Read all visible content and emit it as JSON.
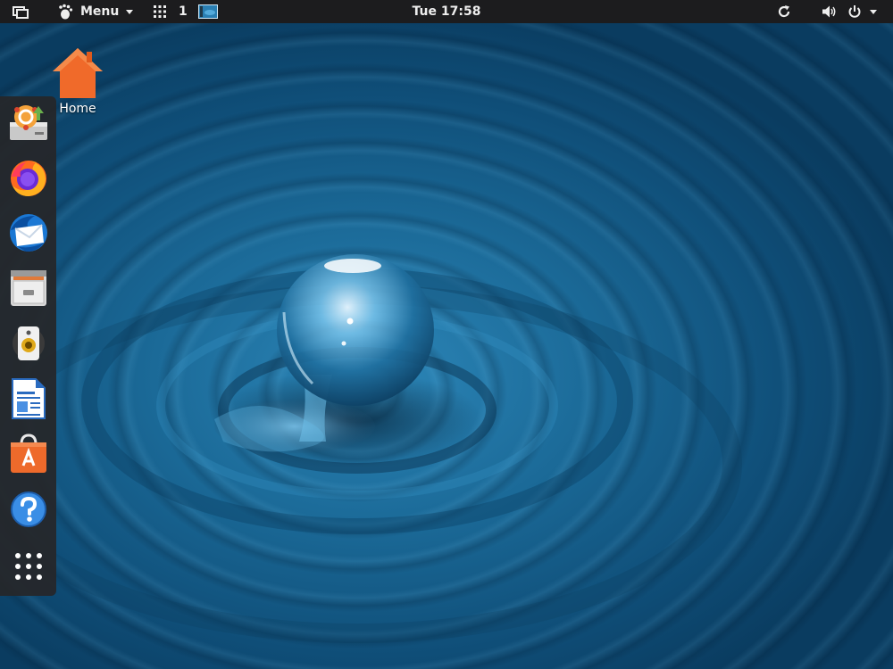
{
  "topbar": {
    "menu_label": "Menu",
    "workspace_number": "1",
    "clock": "Tue 17:58",
    "icons": {
      "window_list": "windows-icon",
      "gnome": "gnome-foot-icon",
      "menu_arrow": "chevron-down-icon",
      "apps_grid": "app-grid-icon",
      "workspace_thumb": "workspace-thumbnail-icon",
      "refresh": "refresh-icon",
      "volume": "volume-icon",
      "power": "power-icon",
      "power_arrow": "chevron-down-icon"
    }
  },
  "desktop": {
    "icons": [
      {
        "label": "Home",
        "icon": "home-folder-icon"
      }
    ]
  },
  "dock": {
    "items": [
      {
        "name": "software-installer",
        "icon": "installer-icon"
      },
      {
        "name": "firefox",
        "icon": "firefox-icon"
      },
      {
        "name": "thunderbird",
        "icon": "thunderbird-icon"
      },
      {
        "name": "files",
        "icon": "file-cabinet-icon"
      },
      {
        "name": "rhythmbox",
        "icon": "speaker-icon"
      },
      {
        "name": "libreoffice-writer",
        "icon": "writer-document-icon"
      },
      {
        "name": "software-center",
        "icon": "shopping-bag-icon"
      },
      {
        "name": "help",
        "icon": "help-icon"
      },
      {
        "name": "show-applications",
        "icon": "app-grid-icon"
      }
    ]
  },
  "colors": {
    "panel": "#1c1c1e",
    "dock": "#262628",
    "wallpaper_blue": "#1b6a98",
    "home_orange": "#f06a2a"
  }
}
